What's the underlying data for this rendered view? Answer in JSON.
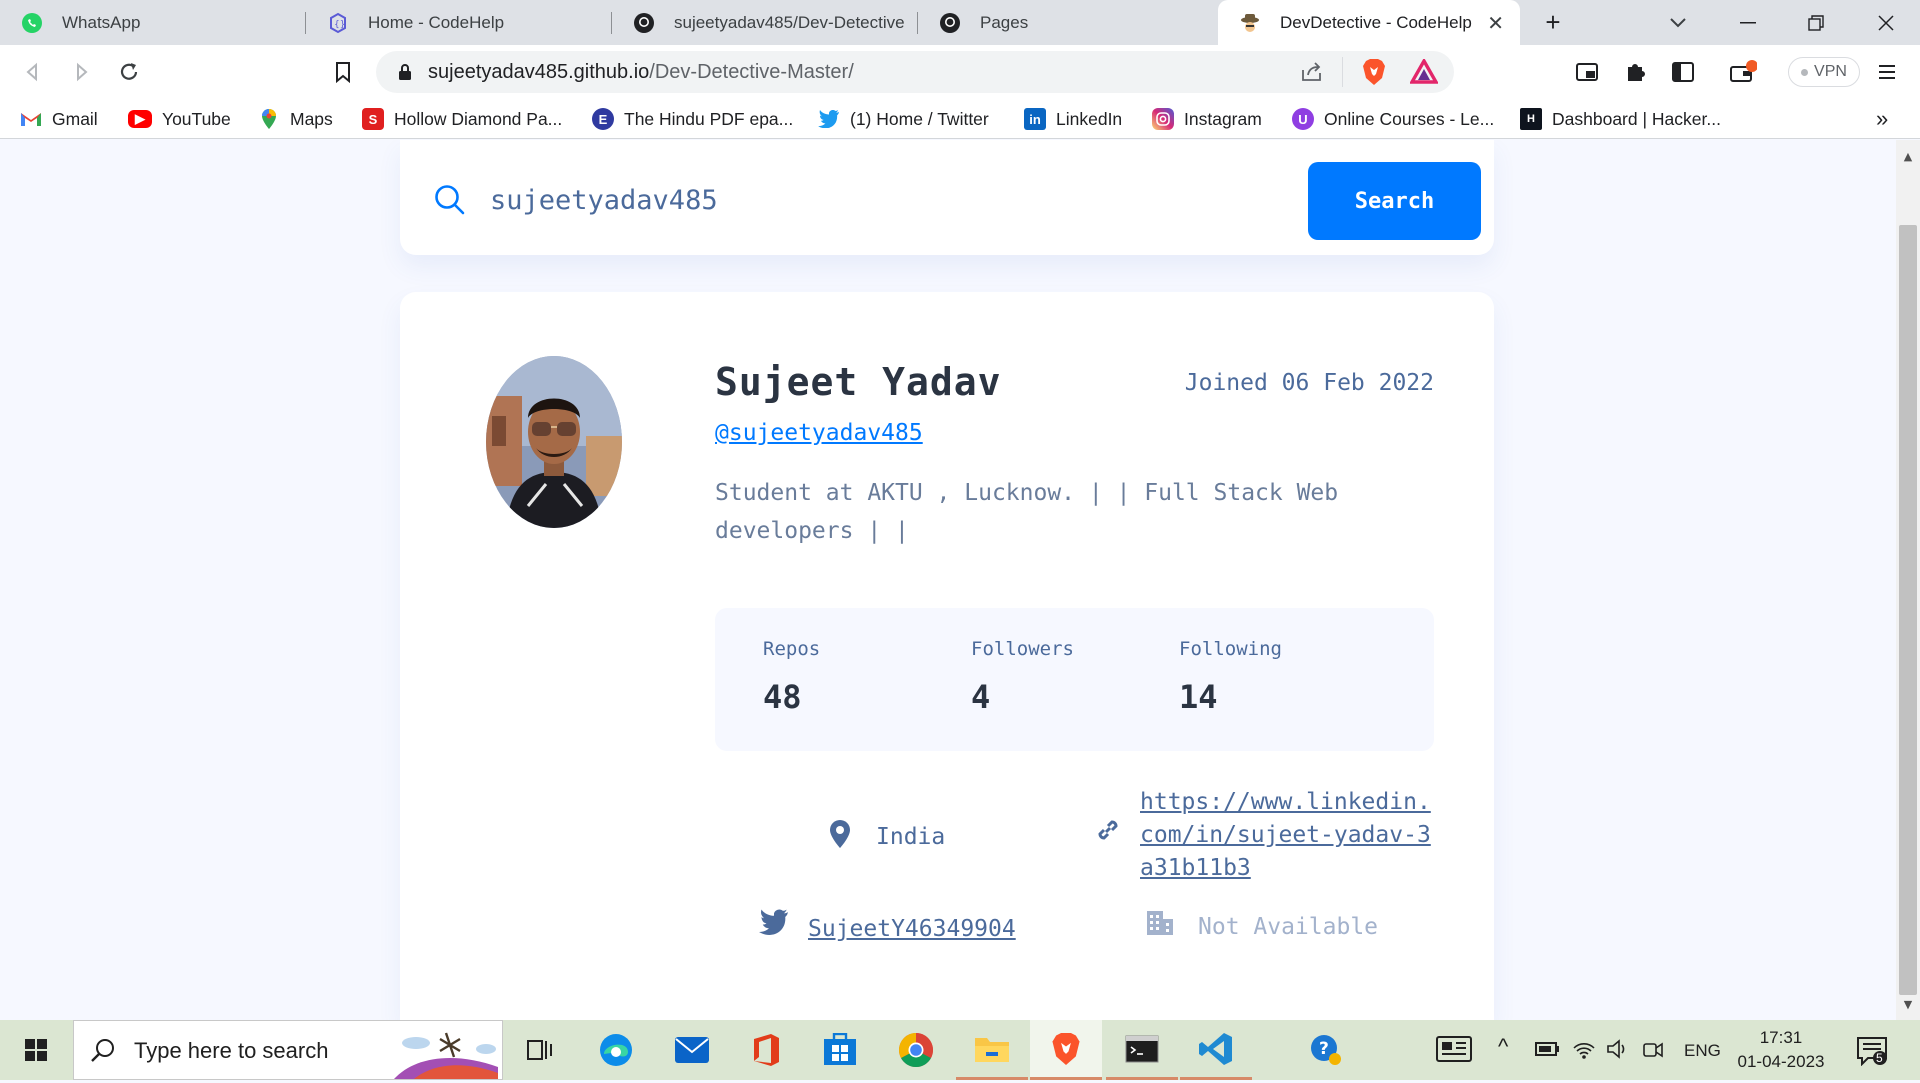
{
  "browser": {
    "tabs": [
      {
        "title": "WhatsApp",
        "icon": "whatsapp-icon"
      },
      {
        "title": "Home - CodeHelp",
        "icon": "codehelp-icon"
      },
      {
        "title": "sujeetyadav485/Dev-Detective",
        "icon": "github-icon"
      },
      {
        "title": "Pages",
        "icon": "github-icon"
      },
      {
        "title": "DevDetective - CodeHelp",
        "icon": "detective-icon",
        "active": true
      }
    ],
    "url_host": "sujeetyadav485.github.io",
    "url_path": "/Dev-Detective-Master/",
    "vpn_label": "VPN",
    "bookmarks": [
      {
        "label": "Gmail",
        "icon": "gmail-icon"
      },
      {
        "label": "YouTube",
        "icon": "youtube-icon"
      },
      {
        "label": "Maps",
        "icon": "maps-icon"
      },
      {
        "label": "Hollow Diamond Pa...",
        "icon": "bookmark-s-icon"
      },
      {
        "label": "The Hindu PDF epa...",
        "icon": "bookmark-e-icon"
      },
      {
        "label": "(1) Home / Twitter",
        "icon": "twitter-icon"
      },
      {
        "label": "LinkedIn",
        "icon": "linkedin-icon"
      },
      {
        "label": "Instagram",
        "icon": "instagram-icon"
      },
      {
        "label": "Online Courses - Le...",
        "icon": "udemy-icon"
      },
      {
        "label": "Dashboard | Hacker...",
        "icon": "hackerrank-icon"
      }
    ],
    "more_bookmarks": "»"
  },
  "search": {
    "value": "sujeetyadav485",
    "button_label": "Search"
  },
  "profile": {
    "name": "Sujeet Yadav",
    "joined": "Joined 06 Feb 2022",
    "handle": "@sujeetyadav485",
    "bio": "Student at AKTU , Lucknow. | | Full Stack Web developers | |",
    "stats": {
      "repos_label": "Repos",
      "repos": "48",
      "followers_label": "Followers",
      "followers": "4",
      "following_label": "Following",
      "following": "14"
    },
    "location": "India",
    "website_line1": "https://www.linkedin.",
    "website_line2": "com/in/sujeet-yadav-3",
    "website_line3": "a31b11b3",
    "twitter": "SujeetY46349904",
    "company": "Not Available"
  },
  "taskbar": {
    "search_placeholder": "Type here to search",
    "lang": "ENG",
    "time": "17:31",
    "date": "01-04-2023",
    "notifications": "5"
  },
  "colors": {
    "accent": "#0079ff",
    "text_dark": "#2b3442",
    "text_muted": "#4b6a9b",
    "bg": "#f6f8ff"
  }
}
